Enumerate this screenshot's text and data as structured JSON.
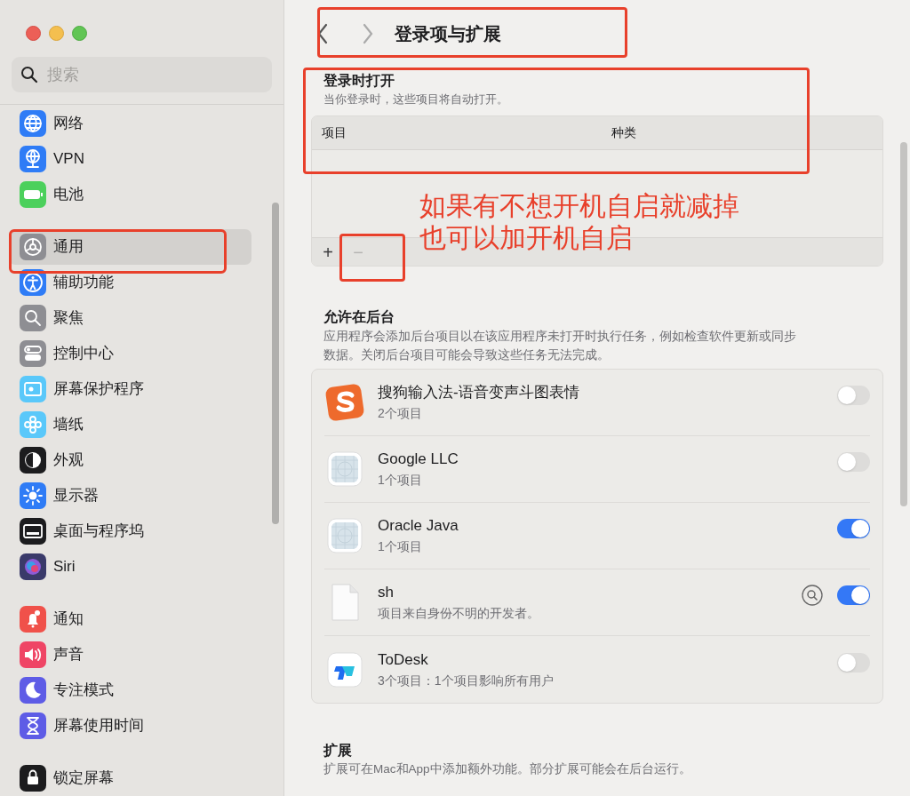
{
  "window": {
    "title": "登录项与扩展"
  },
  "sidebar": {
    "search": {
      "placeholder": "搜索"
    },
    "groups": [
      [
        {
          "label": "网络",
          "kind": "globe",
          "color": "#2f7cf6",
          "selected": false
        },
        {
          "label": "VPN",
          "kind": "vpn",
          "color": "#2f7cf6",
          "selected": false
        },
        {
          "label": "电池",
          "kind": "battery",
          "color": "#4cd05c",
          "selected": false
        }
      ],
      [
        {
          "label": "通用",
          "kind": "gear",
          "color": "#8e8e93",
          "selected": true
        },
        {
          "label": "辅助功能",
          "kind": "accessibility",
          "color": "#2f7cf6",
          "selected": false
        },
        {
          "label": "聚焦",
          "kind": "search",
          "color": "#8e8e93",
          "selected": false
        },
        {
          "label": "控制中心",
          "kind": "switches",
          "color": "#8e8e93",
          "selected": false
        },
        {
          "label": "屏幕保护程序",
          "kind": "screensaver",
          "color": "#5ac8fa",
          "selected": false
        },
        {
          "label": "墙纸",
          "kind": "flower",
          "color": "#5ac8fa",
          "selected": false
        },
        {
          "label": "外观",
          "kind": "appearance",
          "color": "#1c1c1e",
          "selected": false
        },
        {
          "label": "显示器",
          "kind": "sun",
          "color": "#2f7cf6",
          "selected": false
        },
        {
          "label": "桌面与程序坞",
          "kind": "dock",
          "color": "#1c1c1e",
          "selected": false
        },
        {
          "label": "Siri",
          "kind": "siri",
          "color": "#3a3a6a",
          "selected": false
        }
      ],
      [
        {
          "label": "通知",
          "kind": "bell",
          "color": "#f0514a",
          "selected": false
        },
        {
          "label": "声音",
          "kind": "speaker",
          "color": "#ef4565",
          "selected": false
        },
        {
          "label": "专注模式",
          "kind": "moon",
          "color": "#5e5ce6",
          "selected": false
        },
        {
          "label": "屏幕使用时间",
          "kind": "hourglass",
          "color": "#5e5ce6",
          "selected": false
        }
      ],
      [
        {
          "label": "锁定屏幕",
          "kind": "lock",
          "color": "#1c1c1e",
          "selected": false
        }
      ]
    ]
  },
  "login_items": {
    "title": "登录时打开",
    "description": "当你登录时，这些项目将自动打开。",
    "columns": [
      "项目",
      "种类"
    ],
    "buttons": [
      {
        "label": "+",
        "disabled": false
      },
      {
        "label": "−",
        "disabled": true
      }
    ]
  },
  "background": {
    "title": "允许在后台",
    "description": "应用程序会添加后台项目以在该应用程序未打开时执行任务，例如检查软件更新或同步数据。关闭后台项目可能会导致这些任务无法完成。",
    "items": [
      {
        "name": "搜狗输入法-语音变声斗图表情",
        "detail": "2个项目",
        "kind": "sogou",
        "info_button": false,
        "on": false
      },
      {
        "name": "Google LLC",
        "detail": "1个项目",
        "kind": "generic",
        "info_button": false,
        "on": false
      },
      {
        "name": "Oracle Java",
        "detail": "1个项目",
        "kind": "generic",
        "info_button": false,
        "on": true
      },
      {
        "name": "sh",
        "detail": "项目来自身份不明的开发者。",
        "kind": "document",
        "info_button": true,
        "on": true
      },
      {
        "name": "ToDesk",
        "detail": "3个项目：1个项目影响所有用户",
        "kind": "todesk",
        "info_button": false,
        "on": false
      }
    ]
  },
  "extensions": {
    "title": "扩展",
    "description": "扩展可在Mac和App中添加额外功能。部分扩展可能会在后台运行。"
  },
  "annotation": {
    "lines": [
      "如果有不想开机自启就减掉",
      "也可以加开机自启"
    ]
  }
}
